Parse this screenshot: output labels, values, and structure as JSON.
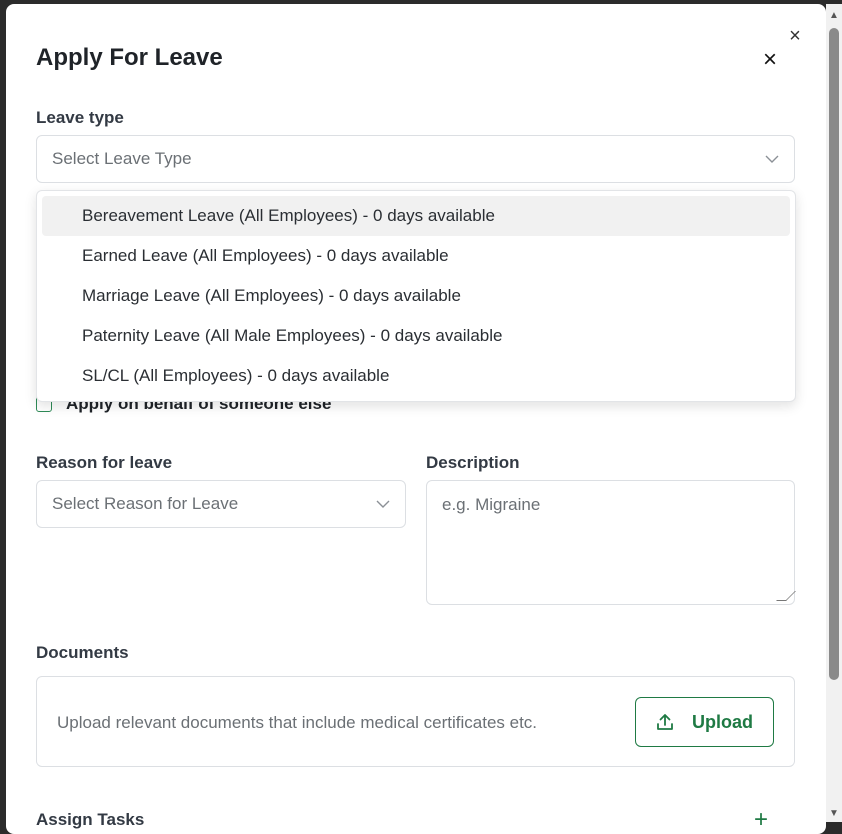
{
  "modal": {
    "title": "Apply For Leave",
    "close_glyph": "×",
    "outer_close_glyph": "×"
  },
  "leave_type": {
    "label": "Leave type",
    "placeholder": "Select Leave Type",
    "options": [
      "Bereavement Leave (All Employees) - 0 days available",
      "Earned Leave (All Employees) - 0 days available",
      "Marriage Leave (All Employees) - 0 days available",
      "Paternity Leave (All Male Employees) - 0 days available",
      "SL/CL (All Employees) - 0 days available"
    ],
    "highlighted_index": 0
  },
  "on_behalf": {
    "label": "Apply on behalf of someone else",
    "checked": false
  },
  "reason": {
    "label": "Reason for leave",
    "placeholder": "Select Reason for Leave"
  },
  "description": {
    "label": "Description",
    "placeholder": "e.g. Migraine"
  },
  "documents": {
    "label": "Documents",
    "hint": "Upload relevant documents that include medical certificates etc.",
    "upload_label": "Upload"
  },
  "assign_tasks": {
    "label": "Assign Tasks",
    "add_glyph": "+"
  },
  "colors": {
    "accent": "#1f7a44",
    "highlight": "#f1f1f1",
    "border": "#dcdfe3"
  },
  "icons": {
    "close": "close-icon",
    "chevron": "chevron-down-icon",
    "upload": "upload-icon",
    "add": "plus-icon"
  }
}
